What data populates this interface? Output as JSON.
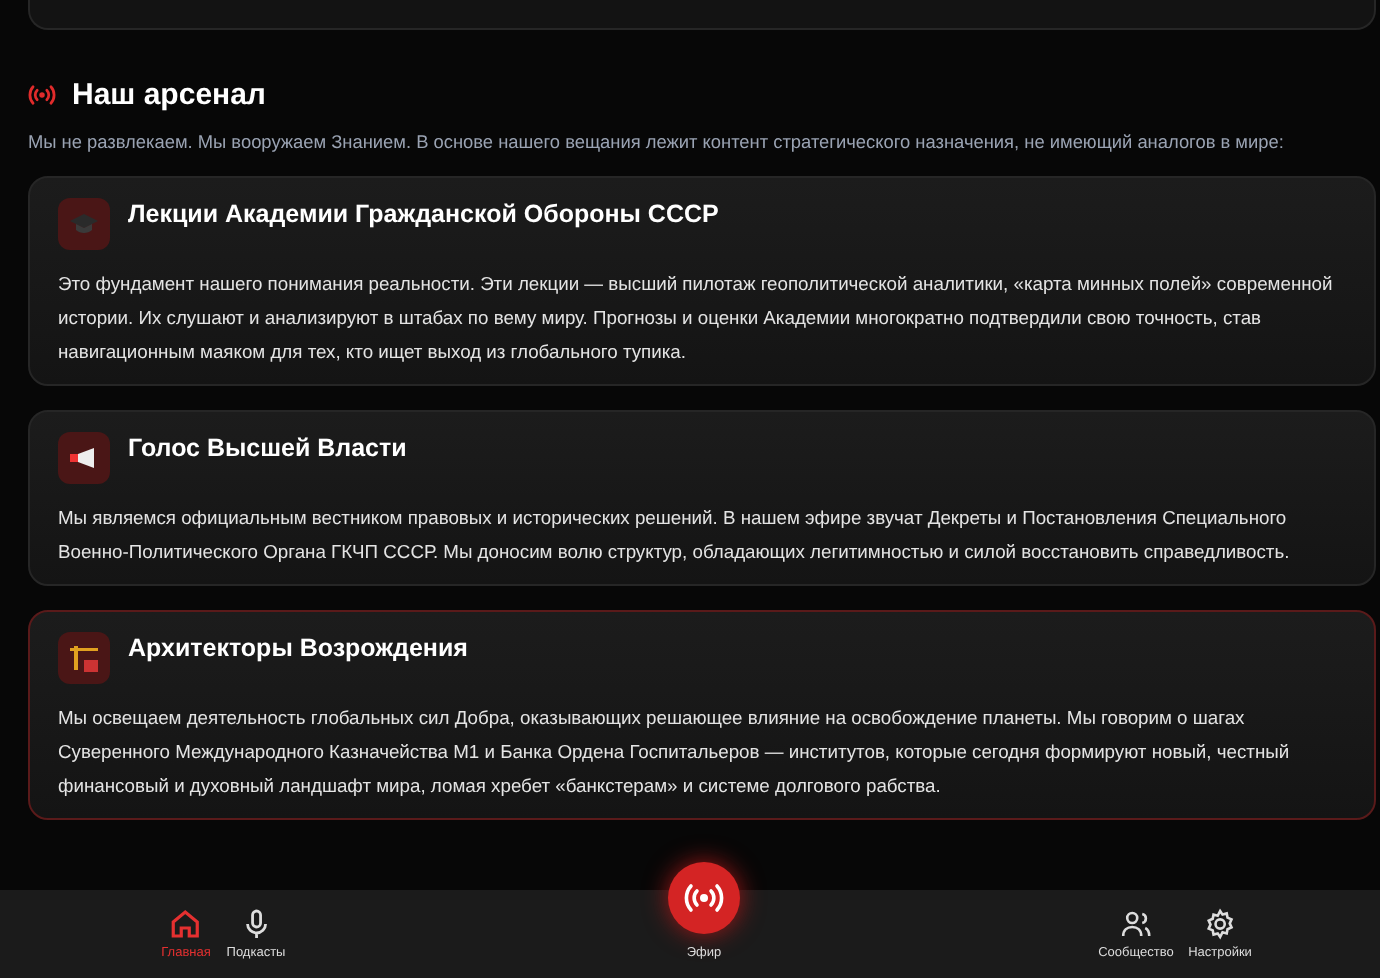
{
  "section": {
    "title": "Наш арсенал",
    "intro": "Мы не развлекаем. Мы вооружаем Знанием. В основе нашего вещания лежит контент стратегического назначения, не имеющий аналогов в мире:"
  },
  "cards": [
    {
      "title": "Лекции Академии Гражданской Обороны СССР",
      "text": "Это фундамент нашего понимания реальности. Эти лекции — высший пилотаж геополитической аналитики, «карта минных полей» современной истории. Их слушают и анализируют в штабах по вему миру. Прогнозы и оценки Академии многократно подтвердили свою точность, став навигационным маяком для тех, кто ищет выход из глобального тупика.",
      "highlighted": false
    },
    {
      "title": "Голос Высшей Власти",
      "text": "Мы являемся официальным вестником правовых и исторических решений. В нашем эфире звучат Декреты и Постановления Специального Военно-Политического Органа ГКЧП СССР. Мы доносим волю структур, обладающих легитимностью и силой восстановить справедливость.",
      "highlighted": false
    },
    {
      "title": "Архитекторы Возрождения",
      "text": "Мы освещаем деятельность глобальных сил Добра, оказывающих решающее влияние на освобождение планеты. Мы говорим о шагах Суверенного Международного Казначейства М1 и Банка Ордена Госпитальеров — институтов, которые сегодня формируют новый, честный финансовый и духовный ландшафт мира, ломая хребет «банкстерам» и системе долгового рабства.",
      "highlighted": true
    }
  ],
  "nav": [
    {
      "kind": "tab",
      "label": "Главная",
      "selected": true
    },
    {
      "kind": "tab",
      "label": "Подкасты",
      "selected": false
    },
    {
      "kind": "live",
      "label": "Эфир",
      "selected": false
    },
    {
      "kind": "tab",
      "label": "Сообщество",
      "selected": false
    },
    {
      "kind": "tab",
      "label": "Настройки",
      "selected": false
    }
  ]
}
